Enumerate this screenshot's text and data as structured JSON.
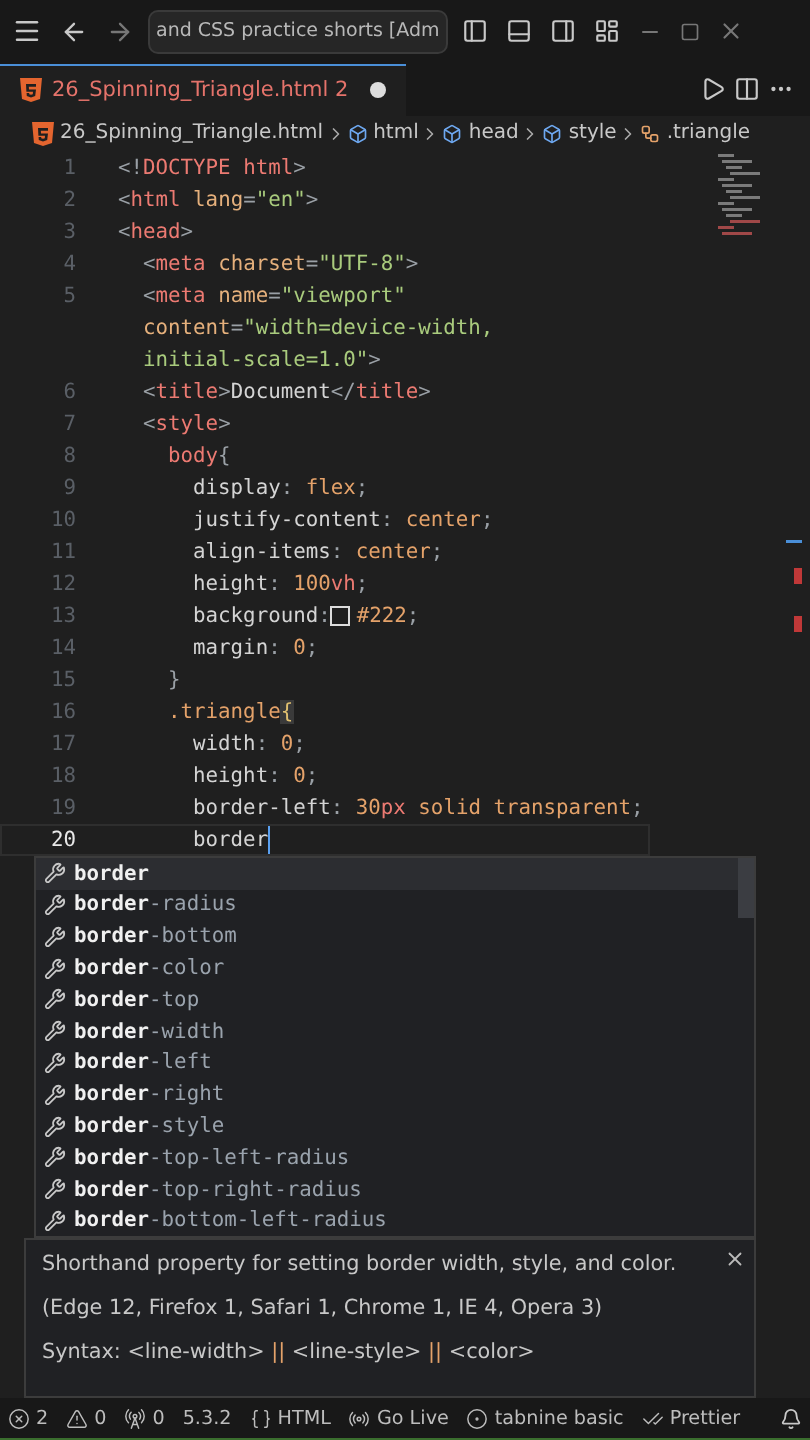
{
  "title_bar": {
    "search": "and CSS practice shorts [Adm"
  },
  "tab": {
    "label": "26_Spinning_Triangle.html",
    "problems": "2",
    "modified": true
  },
  "breadcrumbs": [
    {
      "kind": "file",
      "label": "26_Spinning_Triangle.html"
    },
    {
      "kind": "element",
      "label": "html"
    },
    {
      "kind": "element",
      "label": "head"
    },
    {
      "kind": "element",
      "label": "style"
    },
    {
      "kind": "selector",
      "label": ".triangle"
    }
  ],
  "lines": [
    {
      "number": "1",
      "current": false,
      "tokens": [
        {
          "kind": "punct",
          "text": "<!"
        },
        {
          "kind": "tag",
          "text": "DOCTYPE"
        },
        {
          "kind": "tag",
          "text": " html"
        },
        {
          "kind": "punct",
          "text": ">"
        }
      ]
    },
    {
      "number": "2",
      "current": false,
      "tokens": [
        {
          "kind": "punct",
          "text": "<"
        },
        {
          "kind": "tag",
          "text": "html"
        },
        {
          "kind": "attr",
          "text": " lang"
        },
        {
          "kind": "punct",
          "text": "="
        },
        {
          "kind": "string",
          "text": "\"en\""
        },
        {
          "kind": "punct",
          "text": ">"
        }
      ]
    },
    {
      "number": "3",
      "current": false,
      "tokens": [
        {
          "kind": "punct",
          "text": "<"
        },
        {
          "kind": "tag",
          "text": "head"
        },
        {
          "kind": "punct",
          "text": ">"
        }
      ]
    },
    {
      "number": "4",
      "current": false,
      "tokens": [
        {
          "kind": "punct",
          "text": "  <"
        },
        {
          "kind": "tag",
          "text": "meta"
        },
        {
          "kind": "attr",
          "text": " charset"
        },
        {
          "kind": "punct",
          "text": "="
        },
        {
          "kind": "string",
          "text": "\"UTF-8\""
        },
        {
          "kind": "punct",
          "text": ">"
        }
      ]
    },
    {
      "number": "5",
      "current": false,
      "tokens": [
        {
          "kind": "punct",
          "text": "  <"
        },
        {
          "kind": "tag",
          "text": "meta"
        },
        {
          "kind": "attr",
          "text": " name"
        },
        {
          "kind": "punct",
          "text": "="
        },
        {
          "kind": "string",
          "text": "\"viewport\""
        }
      ]
    },
    {
      "current": false,
      "tokens": [
        {
          "kind": "attr",
          "text": "  content"
        },
        {
          "kind": "punct",
          "text": "="
        },
        {
          "kind": "string",
          "text": "\"width=device-width,"
        }
      ]
    },
    {
      "current": false,
      "tokens": [
        {
          "kind": "string",
          "text": "  initial-scale=1.0\""
        },
        {
          "kind": "punct",
          "text": ">"
        }
      ]
    },
    {
      "number": "6",
      "current": false,
      "tokens": [
        {
          "kind": "punct",
          "text": "  <"
        },
        {
          "kind": "tag",
          "text": "title"
        },
        {
          "kind": "punct",
          "text": ">"
        },
        {
          "kind": "plain",
          "text": "Document"
        },
        {
          "kind": "punct",
          "text": "</"
        },
        {
          "kind": "tag",
          "text": "title"
        },
        {
          "kind": "punct",
          "text": ">"
        }
      ]
    },
    {
      "number": "7",
      "current": false,
      "tokens": [
        {
          "kind": "punct",
          "text": "  <"
        },
        {
          "kind": "tag",
          "text": "style"
        },
        {
          "kind": "punct",
          "text": ">"
        }
      ]
    },
    {
      "number": "8",
      "current": false,
      "tokens": [
        {
          "kind": "tag",
          "text": "    body"
        },
        {
          "kind": "punct",
          "text": "{"
        }
      ]
    },
    {
      "number": "9",
      "current": false,
      "tokens": [
        {
          "kind": "prop",
          "text": "      display"
        },
        {
          "kind": "punct",
          "text": ":"
        },
        {
          "kind": "value",
          "text": " flex"
        },
        {
          "kind": "punct",
          "text": ";"
        }
      ]
    },
    {
      "number": "10",
      "current": false,
      "tokens": [
        {
          "kind": "prop",
          "text": "      justify-content"
        },
        {
          "kind": "punct",
          "text": ":"
        },
        {
          "kind": "value",
          "text": " center"
        },
        {
          "kind": "punct",
          "text": ";"
        }
      ]
    },
    {
      "number": "11",
      "current": false,
      "tokens": [
        {
          "kind": "prop",
          "text": "      align-items"
        },
        {
          "kind": "punct",
          "text": ":"
        },
        {
          "kind": "value",
          "text": " center"
        },
        {
          "kind": "punct",
          "text": ";"
        }
      ]
    },
    {
      "number": "12",
      "current": false,
      "tokens": [
        {
          "kind": "prop",
          "text": "      height"
        },
        {
          "kind": "punct",
          "text": ":"
        },
        {
          "kind": "value",
          "text": " 100"
        },
        {
          "kind": "unit",
          "text": "vh"
        },
        {
          "kind": "punct",
          "text": ";"
        }
      ]
    },
    {
      "number": "13",
      "current": false,
      "tokens": [
        {
          "kind": "prop",
          "text": "      background"
        },
        {
          "kind": "punct",
          "text": ":"
        },
        {
          "kind": "color",
          "text": "#222"
        },
        {
          "kind": "punct",
          "text": ";"
        }
      ]
    },
    {
      "number": "14",
      "current": false,
      "tokens": [
        {
          "kind": "prop",
          "text": "      margin"
        },
        {
          "kind": "punct",
          "text": ":"
        },
        {
          "kind": "value",
          "text": " 0"
        },
        {
          "kind": "punct",
          "text": ";"
        }
      ]
    },
    {
      "number": "15",
      "current": false,
      "tokens": [
        {
          "kind": "punct",
          "text": "    }"
        }
      ]
    },
    {
      "number": "16",
      "current": false,
      "tokens": [
        {
          "kind": "selector",
          "text": "    .triangle"
        },
        {
          "kind": "bracket",
          "text": "{"
        }
      ]
    },
    {
      "number": "17",
      "current": false,
      "tokens": [
        {
          "kind": "prop",
          "text": "      width"
        },
        {
          "kind": "punct",
          "text": ":"
        },
        {
          "kind": "value",
          "text": " 0"
        },
        {
          "kind": "punct",
          "text": ";"
        }
      ]
    },
    {
      "number": "18",
      "current": false,
      "tokens": [
        {
          "kind": "prop",
          "text": "      height"
        },
        {
          "kind": "punct",
          "text": ":"
        },
        {
          "kind": "value",
          "text": " 0"
        },
        {
          "kind": "punct",
          "text": ";"
        }
      ]
    },
    {
      "number": "19",
      "current": false,
      "tokens": [
        {
          "kind": "prop",
          "text": "      border-left"
        },
        {
          "kind": "punct",
          "text": ":"
        },
        {
          "kind": "value",
          "text": " 30"
        },
        {
          "kind": "unit",
          "text": "px"
        },
        {
          "kind": "value",
          "text": " solid transparent"
        },
        {
          "kind": "punct",
          "text": ";"
        }
      ]
    },
    {
      "number": "20",
      "current": true,
      "tokens": [
        {
          "kind": "prop",
          "text": "      border"
        }
      ]
    }
  ],
  "suggestions": [
    {
      "match": "border",
      "selected": true
    },
    {
      "match": "border",
      "rest": "-radius",
      "selected": false
    },
    {
      "match": "border",
      "rest": "-bottom",
      "selected": false
    },
    {
      "match": "border",
      "rest": "-color",
      "selected": false
    },
    {
      "match": "border",
      "rest": "-top",
      "selected": false
    },
    {
      "match": "border",
      "rest": "-width",
      "selected": false
    },
    {
      "match": "border",
      "rest": "-left",
      "selected": false
    },
    {
      "match": "border",
      "rest": "-right",
      "selected": false
    },
    {
      "match": "border",
      "rest": "-style",
      "selected": false
    },
    {
      "match": "border",
      "rest": "-top-left-radius",
      "selected": false
    },
    {
      "match": "border",
      "rest": "-top-right-radius",
      "selected": false
    },
    {
      "match": "border",
      "rest": "-bottom-left-radius",
      "selected": false
    }
  ],
  "details": {
    "description": "Shorthand property for setting border width, style, and color.",
    "browsers": "(Edge 12, Firefox 1, Safari 1, Chrome 1, IE 4, Opera 3)",
    "syntax": [
      {
        "kind": "plain",
        "text": "Syntax: <line-width> "
      },
      {
        "kind": "op",
        "text": "||"
      },
      {
        "kind": "plain",
        "text": " <line-style> "
      },
      {
        "kind": "op",
        "text": "||"
      },
      {
        "kind": "plain",
        "text": " <color>"
      }
    ]
  },
  "status_bar": [
    {
      "kind": "errors",
      "text": "2"
    },
    {
      "kind": "warnings",
      "text": "0"
    },
    {
      "kind": "ports",
      "text": "0"
    },
    {
      "kind": "plain",
      "text": "5.3.2"
    },
    {
      "kind": "language",
      "text": "HTML"
    },
    {
      "kind": "live",
      "text": "Go Live"
    },
    {
      "kind": "tabnine",
      "text": "tabnine basic"
    },
    {
      "kind": "prettier",
      "text": "Prettier"
    }
  ]
}
